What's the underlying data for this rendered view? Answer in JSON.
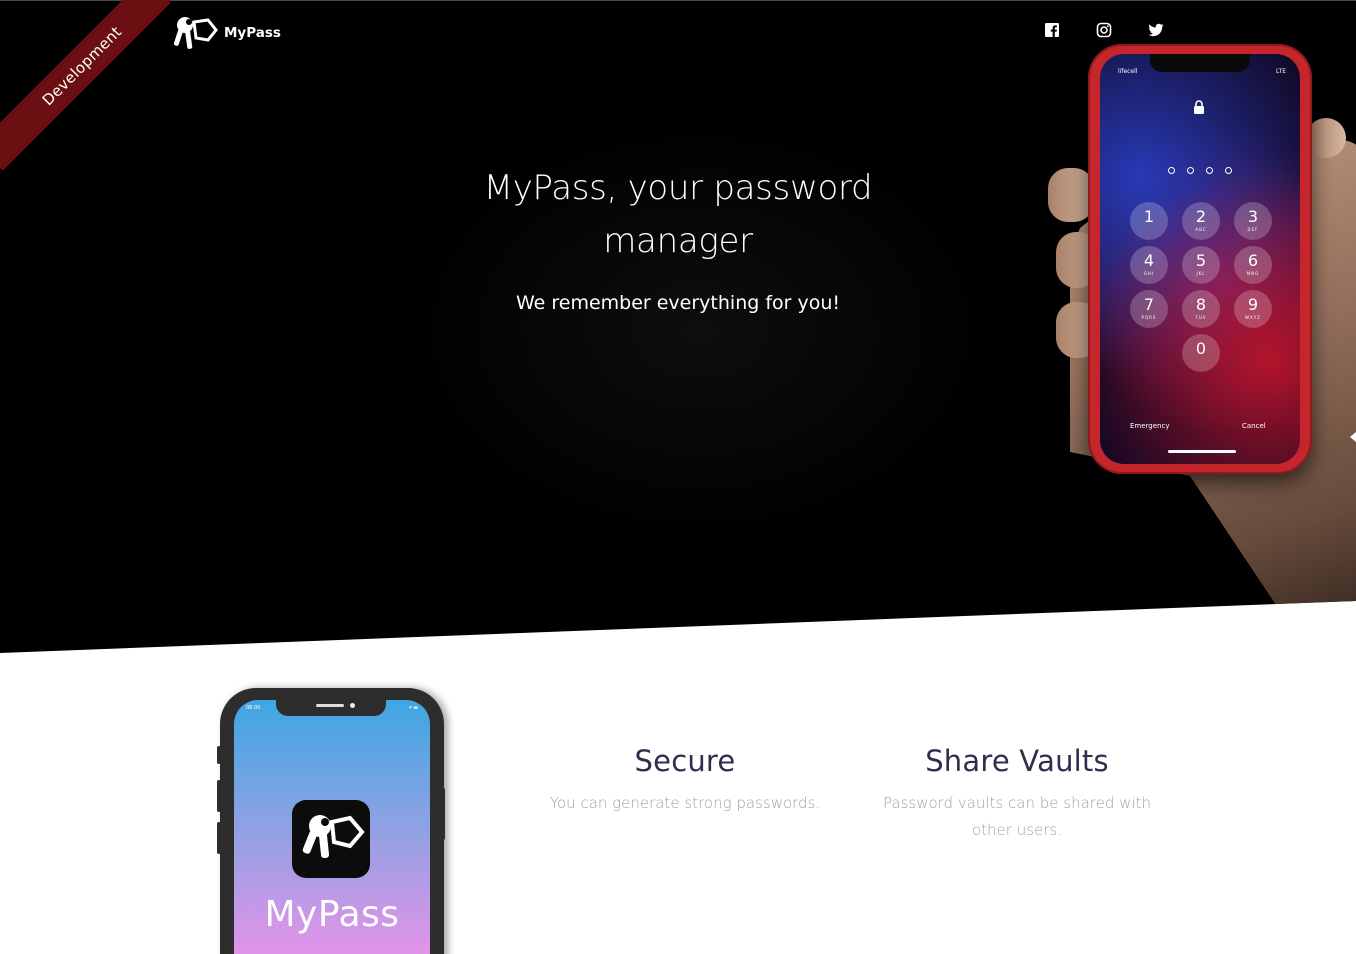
{
  "ribbon": {
    "label": "Development"
  },
  "brand": {
    "name": "MyPass",
    "logo_icon": "keys-icon"
  },
  "social": [
    {
      "name": "facebook-icon",
      "label": "Facebook"
    },
    {
      "name": "instagram-icon",
      "label": "Instagram"
    },
    {
      "name": "twitter-icon",
      "label": "Twitter"
    }
  ],
  "hero": {
    "title": "MyPass, your password manager",
    "subtitle": "We remember everything for you!",
    "phone": {
      "carrier": "lifecell",
      "status": "LTE",
      "keys": [
        {
          "digit": "1",
          "letters": ""
        },
        {
          "digit": "2",
          "letters": "ABC"
        },
        {
          "digit": "3",
          "letters": "DEF"
        },
        {
          "digit": "4",
          "letters": "GHI"
        },
        {
          "digit": "5",
          "letters": "JKL"
        },
        {
          "digit": "6",
          "letters": "MNO"
        },
        {
          "digit": "7",
          "letters": "PQRS"
        },
        {
          "digit": "8",
          "letters": "TUV"
        },
        {
          "digit": "9",
          "letters": "WXYZ"
        },
        {
          "digit": "0",
          "letters": ""
        }
      ],
      "emergency": "Emergency",
      "cancel": "Cancel"
    }
  },
  "mockup": {
    "time": "08.00",
    "app_name": "MyPass"
  },
  "features": [
    {
      "title": "Secure",
      "text": "You can generate strong passwords."
    },
    {
      "title": "Share Vaults",
      "text": "Password vaults can be shared with other users."
    }
  ],
  "colors": {
    "hero_bg": "#000000",
    "ribbon": "#6b0f12",
    "feature_title": "#2d2f4c",
    "feature_text": "#a1a1a8",
    "phone_red": "#c4262c"
  }
}
